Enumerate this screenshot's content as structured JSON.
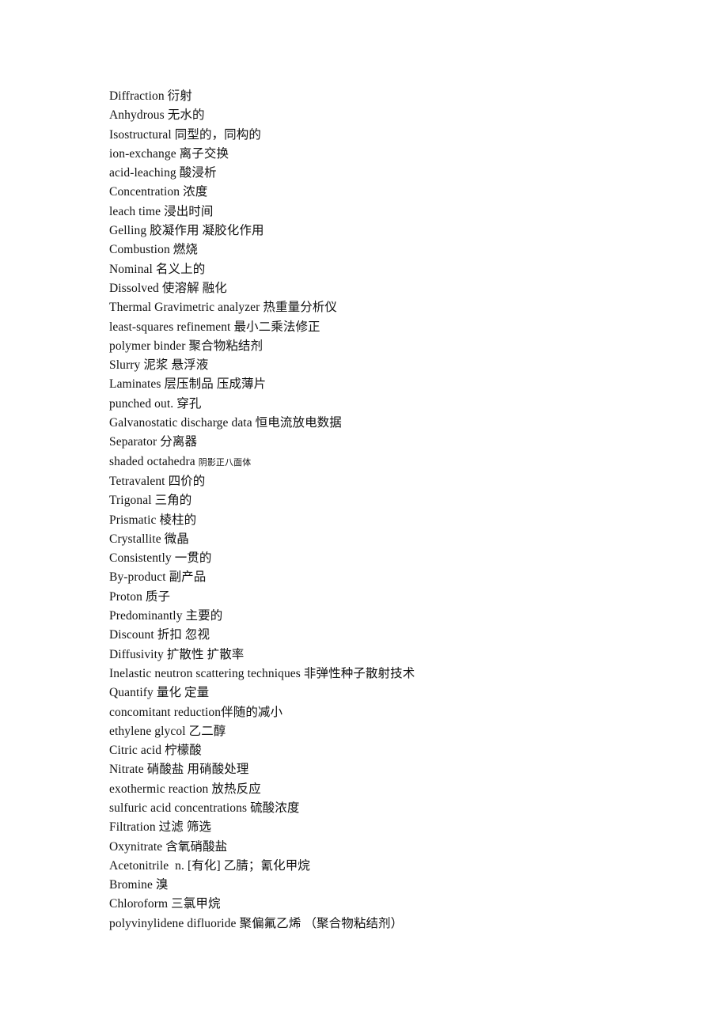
{
  "document": {
    "type": "bilingual-glossary",
    "language_pair": "English-Chinese",
    "background_color": "#ffffff",
    "text_color": "#111111",
    "entry_count": 44,
    "entries": [
      {
        "term": "Diffraction ",
        "gloss": "衍射",
        "small_gloss": false
      },
      {
        "term": "Anhydrous ",
        "gloss": "无水的",
        "small_gloss": false
      },
      {
        "term": "Isostructural ",
        "gloss": "同型的，同构的",
        "small_gloss": false
      },
      {
        "term": "ion-exchange ",
        "gloss": "离子交换",
        "small_gloss": false
      },
      {
        "term": "acid-leaching ",
        "gloss": "酸浸析",
        "small_gloss": false
      },
      {
        "term": "Concentration ",
        "gloss": "浓度",
        "small_gloss": false
      },
      {
        "term": "leach time ",
        "gloss": "浸出时间",
        "small_gloss": false
      },
      {
        "term": "Gelling ",
        "gloss": "胶凝作用 凝胶化作用",
        "small_gloss": false
      },
      {
        "term": "Combustion ",
        "gloss": "燃烧",
        "small_gloss": false
      },
      {
        "term": "Nominal ",
        "gloss": "名义上的",
        "small_gloss": false
      },
      {
        "term": "Dissolved ",
        "gloss": "使溶解 融化",
        "small_gloss": false
      },
      {
        "term": "Thermal Gravimetric analyzer ",
        "gloss": "热重量分析仪",
        "small_gloss": false
      },
      {
        "term": "least-squares refinement ",
        "gloss": "最小二乘法修正",
        "small_gloss": false
      },
      {
        "term": "polymer binder ",
        "gloss": "聚合物粘结剂",
        "small_gloss": false
      },
      {
        "term": "Slurry ",
        "gloss": "泥浆 悬浮液",
        "small_gloss": false
      },
      {
        "term": "Laminates ",
        "gloss": "层压制品 压成薄片",
        "small_gloss": false
      },
      {
        "term": "punched out. ",
        "gloss": "穿孔",
        "small_gloss": false
      },
      {
        "term": "Galvanostatic discharge data ",
        "gloss": "恒电流放电数据",
        "small_gloss": false
      },
      {
        "term": "Separator ",
        "gloss": "分离器",
        "small_gloss": false
      },
      {
        "term": "shaded octahedra ",
        "gloss": "阴影正八面体",
        "small_gloss": true
      },
      {
        "term": "Tetravalent ",
        "gloss": "四价的",
        "small_gloss": false
      },
      {
        "term": "Trigonal ",
        "gloss": "三角的",
        "small_gloss": false
      },
      {
        "term": "Prismatic ",
        "gloss": "棱柱的",
        "small_gloss": false
      },
      {
        "term": "Crystallite ",
        "gloss": "微晶",
        "small_gloss": false
      },
      {
        "term": "Consistently ",
        "gloss": "一贯的",
        "small_gloss": false
      },
      {
        "term": "By-product ",
        "gloss": "副产品",
        "small_gloss": false
      },
      {
        "term": "Proton ",
        "gloss": "质子",
        "small_gloss": false
      },
      {
        "term": "Predominantly ",
        "gloss": "主要的",
        "small_gloss": false
      },
      {
        "term": "Discount ",
        "gloss": "折扣 忽视",
        "small_gloss": false
      },
      {
        "term": "Diffusivity ",
        "gloss": "扩散性 扩散率",
        "small_gloss": false
      },
      {
        "term": "Inelastic neutron scattering techniques ",
        "gloss": "非弹性种子散射技术",
        "small_gloss": false
      },
      {
        "term": "Quantify ",
        "gloss": "量化 定量",
        "small_gloss": false
      },
      {
        "term": "concomitant reduction",
        "gloss": "伴随的减小",
        "small_gloss": false
      },
      {
        "term": "ethylene glycol ",
        "gloss": "乙二醇",
        "small_gloss": false
      },
      {
        "term": "Citric acid ",
        "gloss": "柠檬酸",
        "small_gloss": false
      },
      {
        "term": "Nitrate ",
        "gloss": "硝酸盐 用硝酸处理",
        "small_gloss": false
      },
      {
        "term": "exothermic reaction ",
        "gloss": "放热反应",
        "small_gloss": false
      },
      {
        "term": "sulfuric acid concentrations ",
        "gloss": "硫酸浓度",
        "small_gloss": false
      },
      {
        "term": "Filtration ",
        "gloss": "过滤 筛选",
        "small_gloss": false
      },
      {
        "term": "Oxynitrate ",
        "gloss": "含氧硝酸盐",
        "small_gloss": false
      },
      {
        "term": "Acetonitrile  n. [有化] ",
        "gloss": "乙腈；氰化甲烷",
        "small_gloss": false
      },
      {
        "term": "Bromine ",
        "gloss": "溴",
        "small_gloss": false
      },
      {
        "term": "Chloroform ",
        "gloss": "三氯甲烷",
        "small_gloss": false
      },
      {
        "term": "polyvinylidene difluoride ",
        "gloss": "聚偏氟乙烯 （聚合物粘结剂）",
        "small_gloss": false
      }
    ]
  }
}
